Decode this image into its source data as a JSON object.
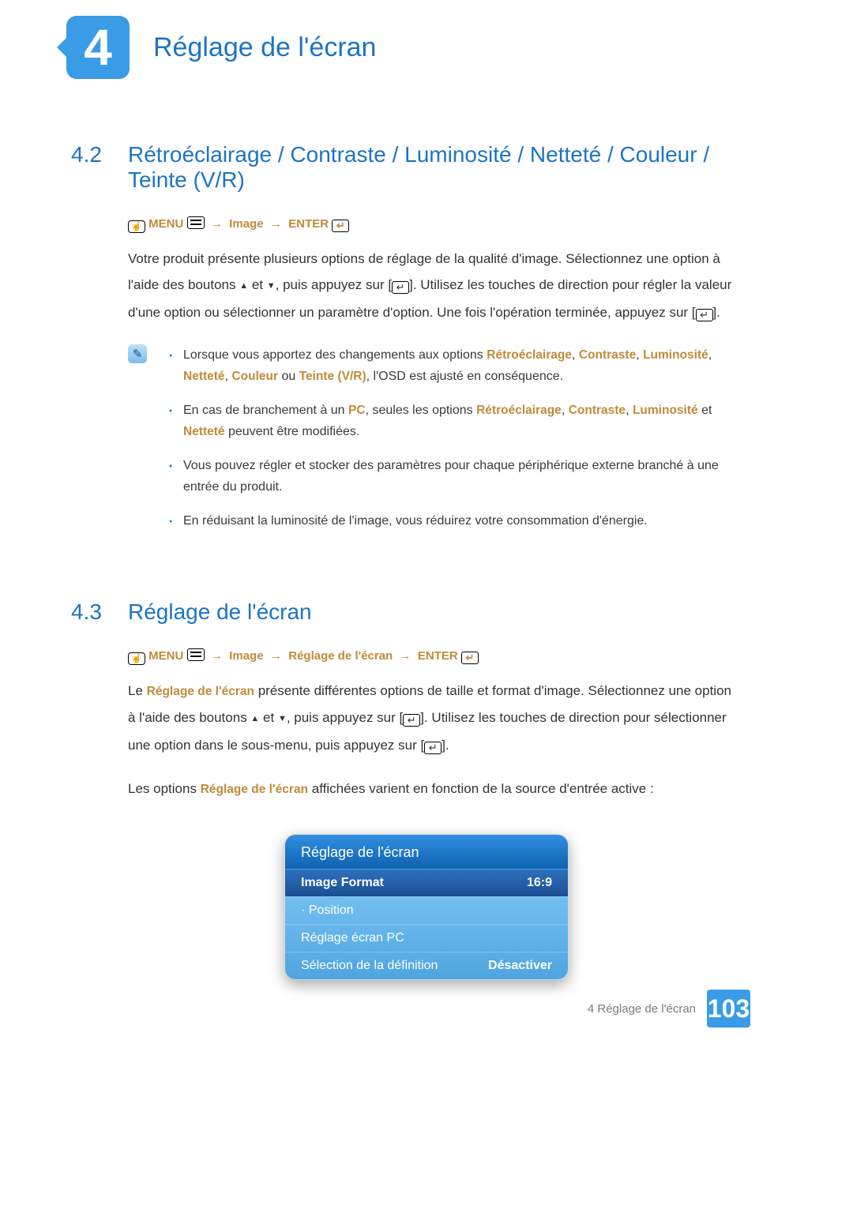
{
  "chapter": {
    "number": "4",
    "title": "Réglage de l'écran"
  },
  "section42": {
    "num": "4.2",
    "title": "Rétroéclairage / Contraste / Luminosité / Netteté / Couleur / Teinte (V/R)",
    "path": {
      "menu": "MENU",
      "image": "Image",
      "enter": "ENTER"
    },
    "para_a": "Votre produit présente plusieurs options de réglage de la qualité d'image. Sélectionnez une option à",
    "para_b_pre": "l'aide des boutons ",
    "para_b_mid": " et ",
    "para_b_post": ", puis appuyez sur [",
    "para_b_end": "]. Utilisez les touches de direction pour régler la valeur",
    "para_c_pre": "d'une option ou sélectionner un paramètre d'option. Une fois l'opération terminée, appuyez sur [",
    "para_c_end": "].",
    "notes": {
      "n1_pre": "Lorsque vous apportez des changements aux options ",
      "n1_ret": "Rétroéclairage",
      "n1_c": "Contraste",
      "n1_l": "Luminosité",
      "n1_mid": ", ",
      "n1_net": "Netteté",
      "n1_col": "Couleur",
      "n1_or": " ou ",
      "n1_tei": "Teinte (V/R)",
      "n1_post": ", l'OSD est ajusté en conséquence.",
      "n2_pre": "En cas de branchement à un ",
      "n2_pc": "PC",
      "n2_mid": ", seules les options ",
      "n2_ret": "Rétroéclairage",
      "n2_con": "Contraste",
      "n2_lum": "Luminosité",
      "n2_et": " et ",
      "n2_net": "Netteté",
      "n2_post": " peuvent être modifiées.",
      "n3": "Vous pouvez régler et stocker des paramètres pour chaque périphérique externe branché à une entrée du produit.",
      "n4": "En réduisant la luminosité de l'image, vous réduirez votre consommation d'énergie."
    }
  },
  "section43": {
    "num": "4.3",
    "title": "Réglage de l'écran",
    "path": {
      "menu": "MENU",
      "image": "Image",
      "reglage": "Réglage de l'écran",
      "enter": "ENTER"
    },
    "para_a_pre": "Le ",
    "para_a_hl": "Réglage de l'écran",
    "para_a_post": " présente différentes options de taille et format d'image. Sélectionnez une option",
    "para_b_pre": "à l'aide des boutons ",
    "para_b_mid": " et ",
    "para_b_post": ", puis appuyez sur [",
    "para_b_end": "]. Utilisez les touches de direction pour sélectionner",
    "para_c_pre": "une option dans le sous-menu, puis appuyez sur [",
    "para_c_end": "].",
    "para_d_pre": "Les options ",
    "para_d_hl": "Réglage de l'écran",
    "para_d_post": " affichées varient en fonction de la source d'entrée active :"
  },
  "osd": {
    "title": "Réglage de l'écran",
    "rows": [
      {
        "label": "Image Format",
        "value": "16:9",
        "selected": true
      },
      {
        "label": "· Position",
        "value": ""
      },
      {
        "label": "Réglage écran PC",
        "value": ""
      },
      {
        "label": "Sélection de la définition",
        "value": "Désactiver"
      }
    ]
  },
  "footer": {
    "label": "4 Réglage de l'écran",
    "page": "103"
  }
}
